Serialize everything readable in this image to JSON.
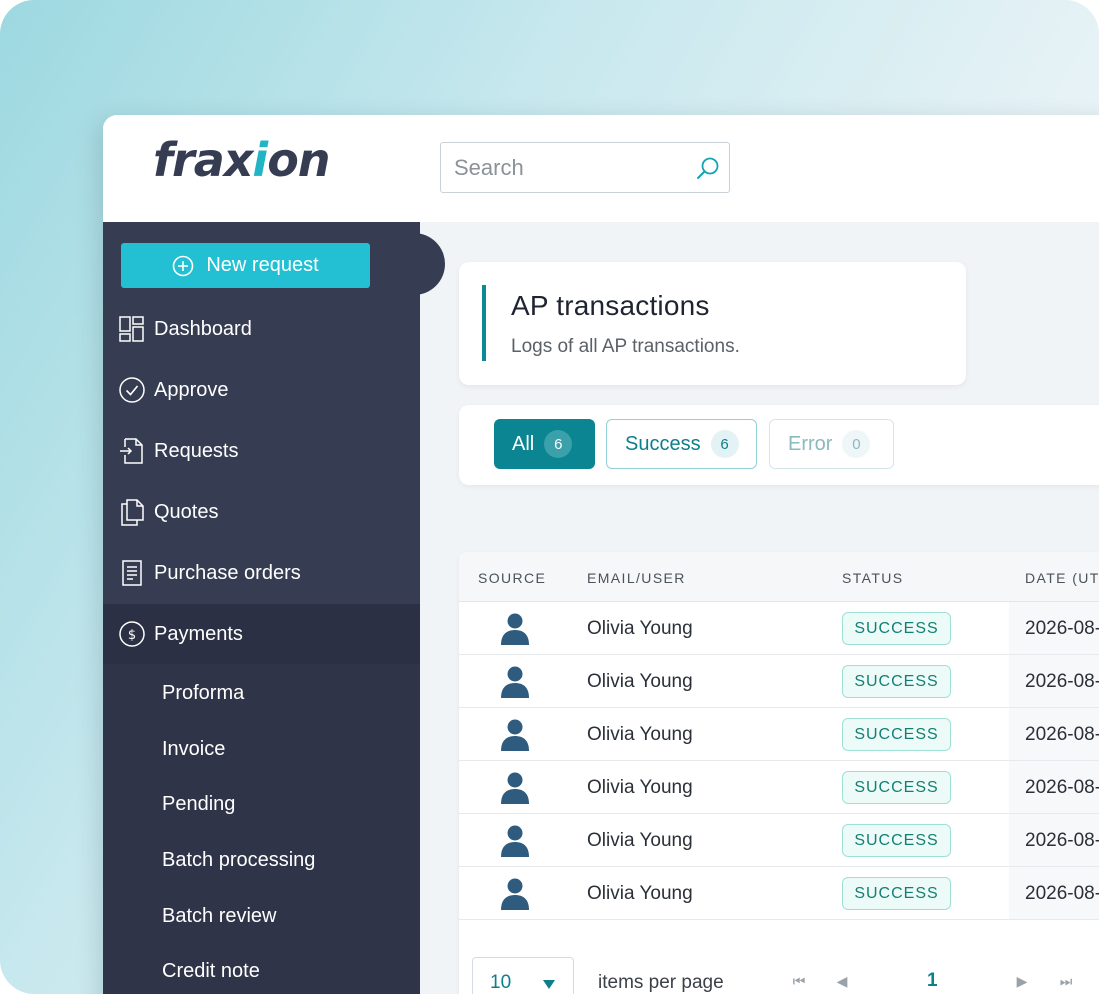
{
  "app": {
    "logo_text_a": "frax",
    "logo_text_b": "i",
    "logo_text_c": "on"
  },
  "search": {
    "placeholder": "Search",
    "value": ""
  },
  "sidebar": {
    "new_request_label": "New request",
    "items": [
      {
        "label": "Dashboard",
        "icon": "dashboard-icon"
      },
      {
        "label": "Approve",
        "icon": "check-circle-icon"
      },
      {
        "label": "Requests",
        "icon": "request-icon"
      },
      {
        "label": "Quotes",
        "icon": "quotes-icon"
      },
      {
        "label": "Purchase orders",
        "icon": "document-icon"
      },
      {
        "label": "Payments",
        "icon": "dollar-circle-icon",
        "active": true
      }
    ],
    "sub_items": [
      {
        "label": "Proforma"
      },
      {
        "label": "Invoice"
      },
      {
        "label": "Pending"
      },
      {
        "label": "Batch processing"
      },
      {
        "label": "Batch review"
      },
      {
        "label": "Credit note"
      }
    ]
  },
  "header": {
    "title": "AP transactions",
    "subtitle": "Logs of all AP transactions."
  },
  "filters": {
    "all": {
      "label": "All",
      "count": "6"
    },
    "success": {
      "label": "Success",
      "count": "6"
    },
    "error": {
      "label": "Error",
      "count": "0"
    }
  },
  "table": {
    "columns": [
      "SOURCE",
      "EMAIL/USER",
      "STATUS",
      "DATE (UT"
    ],
    "rows": [
      {
        "source_icon": "user-icon",
        "user": "Olivia Young",
        "status": "SUCCESS",
        "date": "2026-08-"
      },
      {
        "source_icon": "user-icon",
        "user": "Olivia Young",
        "status": "SUCCESS",
        "date": "2026-08-"
      },
      {
        "source_icon": "user-icon",
        "user": "Olivia Young",
        "status": "SUCCESS",
        "date": "2026-08-"
      },
      {
        "source_icon": "user-icon",
        "user": "Olivia Young",
        "status": "SUCCESS",
        "date": "2026-08-"
      },
      {
        "source_icon": "user-icon",
        "user": "Olivia Young",
        "status": "SUCCESS",
        "date": "2026-08-"
      },
      {
        "source_icon": "user-icon",
        "user": "Olivia Young",
        "status": "SUCCESS",
        "date": "2026-08-"
      }
    ]
  },
  "pagination": {
    "per_page_value": "10",
    "per_page_label": "items per page",
    "current_page": "1"
  },
  "colors": {
    "sidebar": "#363c52",
    "accent": "#22c0d2",
    "primary_teal": "#0b8591",
    "success_border": "#9fe0d6"
  }
}
